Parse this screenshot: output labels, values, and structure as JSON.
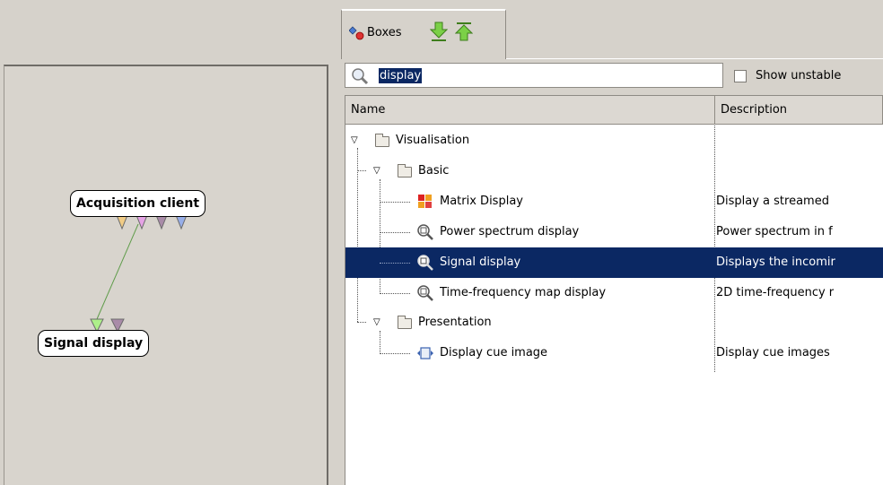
{
  "tab": {
    "label": "Boxes"
  },
  "canvas": {
    "nodes": [
      {
        "label": "Acquisition client"
      },
      {
        "label": "Signal display"
      }
    ]
  },
  "search": {
    "value": "display"
  },
  "show_unstable_label": "Show unstable",
  "columns": {
    "name": "Name",
    "description": "Description"
  },
  "tree": {
    "visualisation": "Visualisation",
    "basic": "Basic",
    "presentation": "Presentation",
    "items": [
      {
        "name": "Matrix Display",
        "description": "Display a streamed",
        "icon": "matrix-display-icon"
      },
      {
        "name": "Power spectrum display",
        "description": "Power spectrum in f",
        "icon": "magnifier-icon"
      },
      {
        "name": "Signal display",
        "description": "Displays the incomir",
        "icon": "magnifier-icon"
      },
      {
        "name": "Time-frequency map display",
        "description": "2D time-frequency r",
        "icon": "magnifier-icon"
      },
      {
        "name": "Display cue image",
        "description": "Display cue images",
        "icon": "cue-image-icon"
      }
    ]
  },
  "colors": {
    "selection": "#0b2863",
    "link_line": "#5f9c4a",
    "panel": "#d6d2cb"
  }
}
